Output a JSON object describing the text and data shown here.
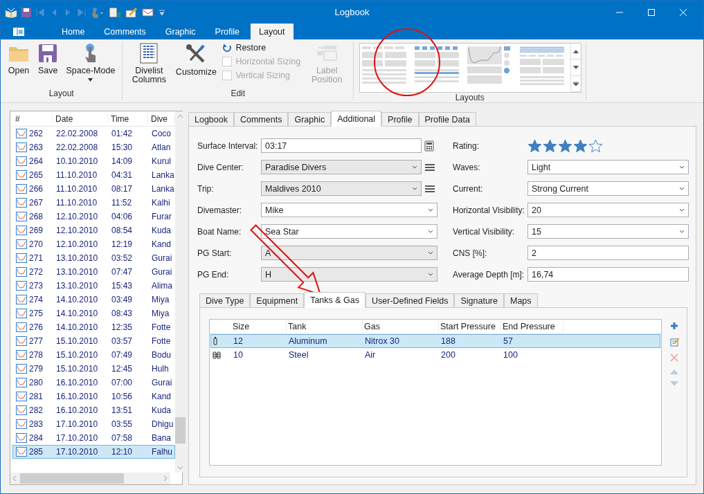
{
  "window": {
    "title": "Logbook"
  },
  "ribbon": {
    "tabs": [
      {
        "label": "Home",
        "selected": false
      },
      {
        "label": "Comments",
        "selected": false
      },
      {
        "label": "Graphic",
        "selected": false
      },
      {
        "label": "Profile",
        "selected": false
      },
      {
        "label": "Layout",
        "selected": true
      }
    ],
    "layout_group": {
      "label": "Layout",
      "buttons": [
        {
          "label": "Open",
          "kind": "folder",
          "dropdown": false
        },
        {
          "label": "Save",
          "kind": "disk",
          "dropdown": false
        },
        {
          "label": "Space-Mode",
          "kind": "hand",
          "dropdown": true
        }
      ]
    },
    "edit_group": {
      "label": "Edit",
      "buttons": [
        {
          "label": "Divelist Columns",
          "kind": "grid"
        },
        {
          "label": "Customize",
          "kind": "tools"
        }
      ],
      "restore": "Restore",
      "checks": [
        {
          "label": "Horizontal Sizing",
          "checked": false,
          "disabled": true
        },
        {
          "label": "Vertical Sizing",
          "checked": false,
          "disabled": true
        }
      ],
      "label_position": {
        "label": "Label Position",
        "disabled": true
      }
    },
    "gallery": {
      "label": "Layouts"
    }
  },
  "divelist": {
    "columns": [
      "#",
      "Date",
      "Time",
      "Dive"
    ],
    "rows": [
      {
        "number": "262",
        "date": "22.02.2008",
        "time": "01:42",
        "site": "Coco",
        "selected": false
      },
      {
        "number": "263",
        "date": "22.02.2008",
        "time": "15:30",
        "site": "Atlan",
        "selected": false
      },
      {
        "number": "264",
        "date": "10.10.2010",
        "time": "14:09",
        "site": "Kurul",
        "selected": false
      },
      {
        "number": "265",
        "date": "11.10.2010",
        "time": "04:31",
        "site": "Lanka",
        "selected": false
      },
      {
        "number": "266",
        "date": "11.10.2010",
        "time": "08:17",
        "site": "Lanka",
        "selected": false
      },
      {
        "number": "267",
        "date": "11.10.2010",
        "time": "11:52",
        "site": "Kalhi",
        "selected": false
      },
      {
        "number": "268",
        "date": "12.10.2010",
        "time": "04:06",
        "site": "Furar",
        "selected": false
      },
      {
        "number": "269",
        "date": "12.10.2010",
        "time": "08:54",
        "site": "Kuda",
        "selected": false
      },
      {
        "number": "270",
        "date": "12.10.2010",
        "time": "12:19",
        "site": "Kand",
        "selected": false
      },
      {
        "number": "271",
        "date": "13.10.2010",
        "time": "03:52",
        "site": "Gurai",
        "selected": false
      },
      {
        "number": "272",
        "date": "13.10.2010",
        "time": "07:47",
        "site": "Gurai",
        "selected": false
      },
      {
        "number": "273",
        "date": "13.10.2010",
        "time": "15:43",
        "site": "Alima",
        "selected": false
      },
      {
        "number": "274",
        "date": "14.10.2010",
        "time": "03:49",
        "site": "Miya",
        "selected": false
      },
      {
        "number": "275",
        "date": "14.10.2010",
        "time": "08:43",
        "site": "Miya",
        "selected": false
      },
      {
        "number": "276",
        "date": "14.10.2010",
        "time": "12:35",
        "site": "Fotte",
        "selected": false
      },
      {
        "number": "277",
        "date": "15.10.2010",
        "time": "03:57",
        "site": "Fotte",
        "selected": false
      },
      {
        "number": "278",
        "date": "15.10.2010",
        "time": "07:49",
        "site": "Bodu",
        "selected": false
      },
      {
        "number": "279",
        "date": "15.10.2010",
        "time": "12:45",
        "site": "Hulh",
        "selected": false
      },
      {
        "number": "280",
        "date": "16.10.2010",
        "time": "07:00",
        "site": "Gurai",
        "selected": false
      },
      {
        "number": "281",
        "date": "16.10.2010",
        "time": "10:56",
        "site": "Kand",
        "selected": false
      },
      {
        "number": "282",
        "date": "16.10.2010",
        "time": "13:51",
        "site": "Kuda",
        "selected": false
      },
      {
        "number": "283",
        "date": "17.10.2010",
        "time": "03:55",
        "site": "Dhigu",
        "selected": false
      },
      {
        "number": "284",
        "date": "17.10.2010",
        "time": "07:58",
        "site": "Bana",
        "selected": false
      },
      {
        "number": "285",
        "date": "17.10.2010",
        "time": "12:10",
        "site": "Falhu",
        "selected": true
      }
    ]
  },
  "detail_tabs": [
    {
      "label": "Logbook",
      "selected": false
    },
    {
      "label": "Comments",
      "selected": false
    },
    {
      "label": "Graphic",
      "selected": false
    },
    {
      "label": "Additional",
      "selected": true
    },
    {
      "label": "Profile",
      "selected": false
    },
    {
      "label": "Profile Data",
      "selected": false
    }
  ],
  "left_fields": [
    {
      "label": "Surface Interval:",
      "value": "03:17",
      "kind": "calc"
    },
    {
      "label": "Dive Center:",
      "value": "Paradise Divers",
      "kind": "picker"
    },
    {
      "label": "Trip:",
      "value": "Maldives 2010",
      "kind": "picker"
    },
    {
      "label": "Divemaster:",
      "value": "Mike",
      "kind": "combo"
    },
    {
      "label": "Boat Name:",
      "value": "Sea Star",
      "kind": "combo"
    },
    {
      "label": "PG Start:",
      "value": "A",
      "kind": "grey"
    },
    {
      "label": "PG End:",
      "value": "H",
      "kind": "grey"
    }
  ],
  "rating": {
    "label": "Rating:",
    "stars": 4
  },
  "right_fields": [
    {
      "label": "Waves:",
      "value": "Light",
      "kind": "combo"
    },
    {
      "label": "Current:",
      "value": "Strong Current",
      "kind": "combo"
    },
    {
      "label": "Horizontal Visibility:",
      "value": "20",
      "kind": "combo"
    },
    {
      "label": "Vertical Visibility:",
      "value": "15",
      "kind": "combo"
    },
    {
      "label": "CNS [%]:",
      "value": "2",
      "kind": "text"
    },
    {
      "label": "Average Depth [m]:",
      "value": "16,74",
      "kind": "text"
    }
  ],
  "sub_tabs": [
    {
      "label": "Dive Type",
      "selected": false
    },
    {
      "label": "Equipment",
      "selected": false
    },
    {
      "label": "Tanks & Gas",
      "selected": true
    },
    {
      "label": "User-Defined Fields",
      "selected": false
    },
    {
      "label": "Signature",
      "selected": false
    },
    {
      "label": "Maps",
      "selected": false
    }
  ],
  "tanks": {
    "columns": [
      "Size",
      "Tank",
      "Gas",
      "Start Pressure",
      "End Pressure"
    ],
    "rows": [
      {
        "kind": "single",
        "cells": [
          "12",
          "Aluminum",
          "Nitrox 30",
          "188",
          "57"
        ],
        "selected": true
      },
      {
        "kind": "double",
        "cells": [
          "10",
          "Steel",
          "Air",
          "200",
          "100"
        ],
        "selected": false
      }
    ]
  }
}
